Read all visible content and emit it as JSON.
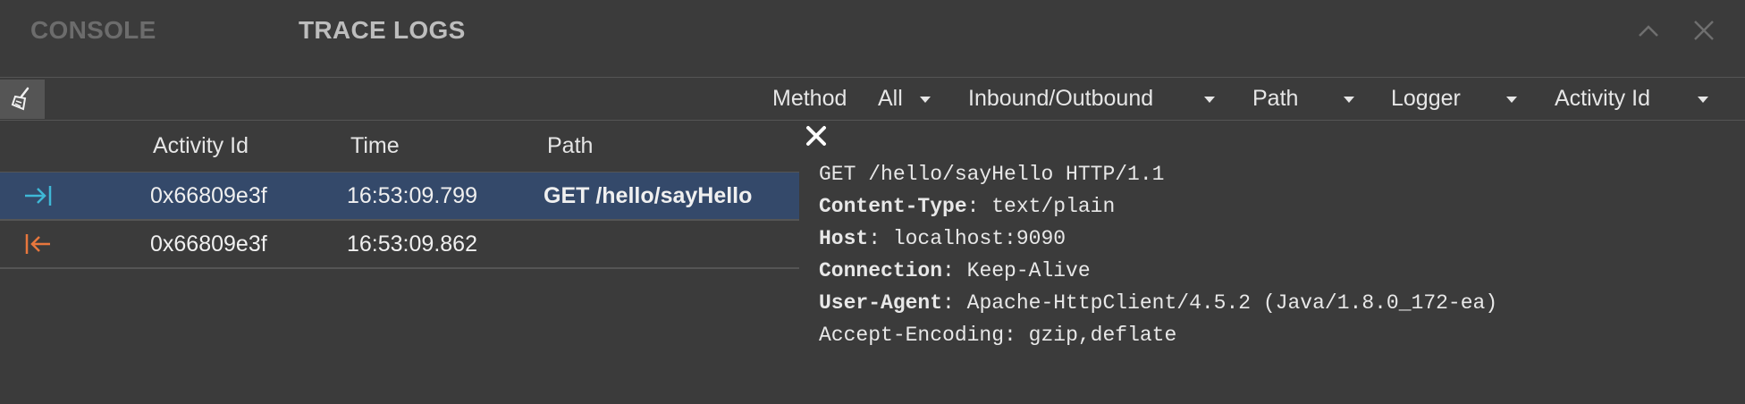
{
  "tabs": [
    {
      "label": "CONSOLE",
      "active": false
    },
    {
      "label": "TRACE LOGS",
      "active": true
    }
  ],
  "filters": {
    "method_label": "Method",
    "method_value": "All",
    "direction_value": "Inbound/Outbound",
    "path_value": "Path",
    "logger_value": "Logger",
    "activity_value": "Activity Id"
  },
  "table": {
    "headers": [
      "Activity Id",
      "Time",
      "Path"
    ],
    "rows": [
      {
        "direction": "inbound",
        "direction_icon": "arrow-right-to-bar-icon",
        "activity_id": "0x66809e3f",
        "time": "16:53:09.799",
        "path": "GET /hello/sayHello",
        "selected": true
      },
      {
        "direction": "outbound",
        "direction_icon": "arrow-left-from-bar-icon",
        "activity_id": "0x66809e3f",
        "time": "16:53:09.862",
        "path": "",
        "selected": false
      }
    ]
  },
  "detail": {
    "request_line": "GET /hello/sayHello HTTP/1.1",
    "headers": [
      {
        "key": "Content-Type",
        "value": "text/plain",
        "bold": true
      },
      {
        "key": "Host",
        "value": "localhost:9090",
        "bold": true
      },
      {
        "key": "Connection",
        "value": "Keep-Alive",
        "bold": true
      },
      {
        "key": "User-Agent",
        "value": "Apache-HttpClient/4.5.2 (Java/1.8.0_172-ea)",
        "bold": true
      },
      {
        "key": "Accept-Encoding",
        "value": "gzip,deflate",
        "bold": false
      }
    ]
  },
  "colors": {
    "background": "#3b3b3b",
    "selected_row": "#34496a",
    "inbound_icon": "#3fb8d6",
    "outbound_icon": "#e8773d"
  },
  "icons": {
    "clear": "broom-icon",
    "minimize": "chevron-up-icon",
    "close": "close-icon",
    "detail_close": "close-x-icon"
  }
}
